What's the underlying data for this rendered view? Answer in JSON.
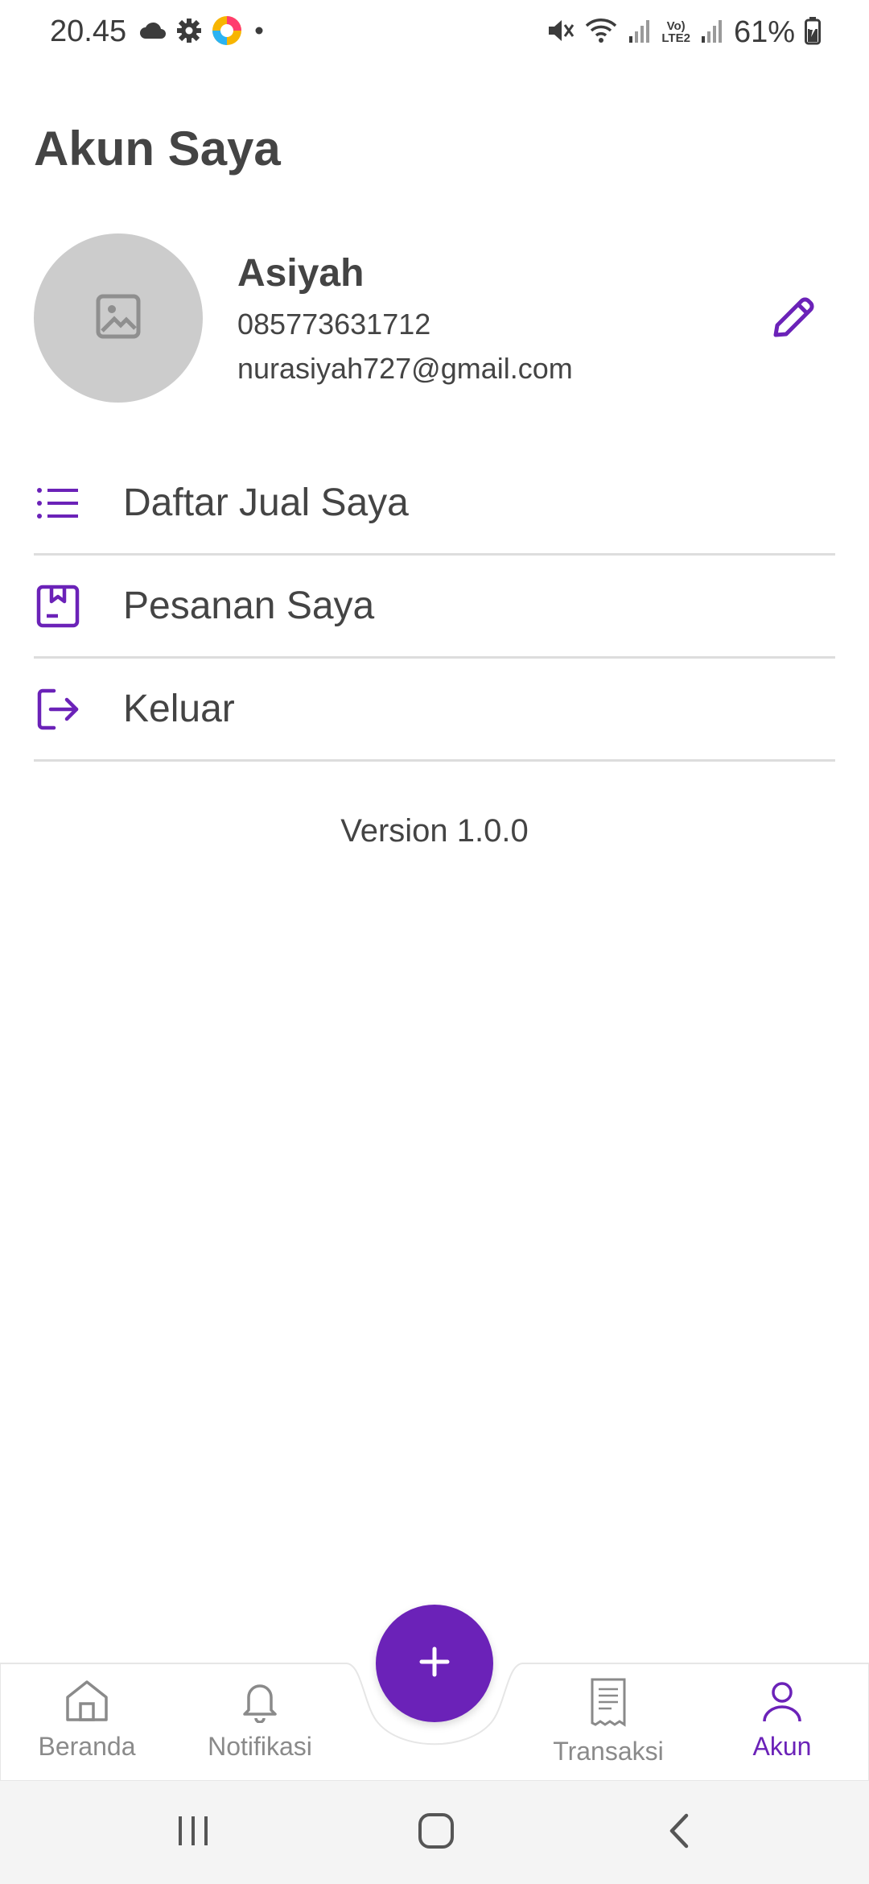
{
  "status_bar": {
    "time": "20.45",
    "battery": "61%",
    "network_label_top": "Vo)",
    "network_label_bottom": "LTE2",
    "icons": [
      "cloud-icon",
      "settings-icon",
      "app-icon",
      "dot-icon",
      "mute-icon",
      "wifi-icon",
      "signal-icon",
      "signal-icon-2",
      "battery-icon"
    ]
  },
  "header": {
    "title": "Akun Saya"
  },
  "profile": {
    "name": "Asiyah",
    "phone": "085773631712",
    "email": "nurasiyah727@gmail.com",
    "avatar_icon": "image-placeholder-icon",
    "edit_icon": "pencil-icon"
  },
  "menu": {
    "items": [
      {
        "label": "Daftar Jual Saya",
        "icon": "list-icon"
      },
      {
        "label": "Pesanan Saya",
        "icon": "bookmark-icon"
      },
      {
        "label": "Keluar",
        "icon": "logout-icon"
      }
    ]
  },
  "version": "Version 1.0.0",
  "bottom_nav": {
    "items": [
      {
        "label": "Beranda",
        "icon": "home-icon"
      },
      {
        "label": "Notifikasi",
        "icon": "bell-icon"
      },
      {
        "label": "Transaksi",
        "icon": "receipt-icon"
      },
      {
        "label": "Akun",
        "icon": "user-icon",
        "active": true
      }
    ],
    "fab_icon": "plus-icon"
  },
  "colors": {
    "accent": "#6b22b8",
    "text": "#444444",
    "muted": "#8a8a8a",
    "avatar_bg": "#cccccc",
    "divider": "#dddddd"
  }
}
